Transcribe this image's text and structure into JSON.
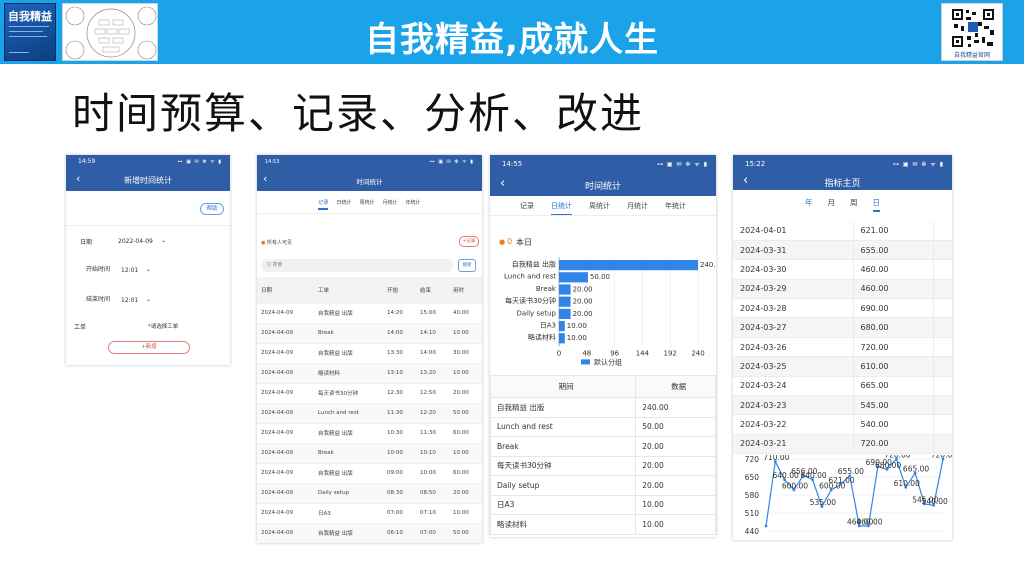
{
  "banner": {
    "title": "自我精益,成就人生",
    "book_title": "自我精益",
    "qr_caption": "自我精益官网",
    "accent": "#1aa3e8"
  },
  "main_title": "时间预算、记录、分析、改进",
  "phone1": {
    "time": "14:59",
    "status_icons": "⊶ ▣ ✉ ✻ ᯤ ▮",
    "title": "新增时间统计",
    "help_button": "帮助",
    "date_label": "日期",
    "date_value": "2022-04-09",
    "start_label": "开始时间",
    "start_value": "12:01",
    "end_label": "结束时间",
    "end_value": "12:01",
    "ticket_label": "工单",
    "ticket_placeholder": "*请选择工单",
    "add_button": "+新增"
  },
  "phone2": {
    "time": "14:53",
    "status_icons": "⊶ ▣ ✉ ✻ ᯤ ▮",
    "title": "时间统计",
    "tabs": [
      "记录",
      "日统计",
      "周统计",
      "月统计",
      "年统计"
    ],
    "visibility": "所有人可见",
    "record_button": "+记录",
    "search_placeholder": "Q 搜索",
    "search_button": "搜索",
    "columns": [
      "日期",
      "工单",
      "开始",
      "结束",
      "用时"
    ],
    "rows": [
      [
        "2024-04-09",
        "自我精益 出版",
        "14:20",
        "15:00",
        "40.00"
      ],
      [
        "2024-04-09",
        "Break",
        "14:00",
        "14:10",
        "10.00"
      ],
      [
        "2024-04-09",
        "自我精益 出版",
        "13:30",
        "14:00",
        "30.00"
      ],
      [
        "2024-04-09",
        "略读材料",
        "13:10",
        "13:20",
        "10.00"
      ],
      [
        "2024-04-09",
        "每天读书30分钟",
        "12:30",
        "12:50",
        "20.00"
      ],
      [
        "2024-04-09",
        "Lunch and rest",
        "11:30",
        "12:20",
        "50.00"
      ],
      [
        "2024-04-09",
        "自我精益 出版",
        "10:30",
        "11:30",
        "60.00"
      ],
      [
        "2024-04-09",
        "Break",
        "10:00",
        "10:10",
        "10.00"
      ],
      [
        "2024-04-09",
        "自我精益 出版",
        "09:00",
        "10:00",
        "60.00"
      ],
      [
        "2024-04-09",
        "Daily setup",
        "08:30",
        "08:50",
        "20.00"
      ],
      [
        "2024-04-09",
        "日A3",
        "07:00",
        "07:10",
        "10.00"
      ],
      [
        "2024-04-09",
        "自我精益 出版",
        "06:10",
        "07:00",
        "50.00"
      ]
    ]
  },
  "phone3": {
    "time": "14:55",
    "status_icons": "⊶ ▣ ✉ ✻ ᯤ ▮",
    "title": "时间统计",
    "tabs": [
      "记录",
      "日统计",
      "周统计",
      "月统计",
      "年统计"
    ],
    "active_tab": 1,
    "period_label": "本日",
    "period_dot": "0",
    "legend": "默认分组",
    "table_headers": [
      "期间",
      "数据"
    ],
    "table_rows": [
      [
        "自我精益 出版",
        "240.00"
      ],
      [
        "Lunch and rest",
        "50.00"
      ],
      [
        "Break",
        "20.00"
      ],
      [
        "每天读书30分钟",
        "20.00"
      ],
      [
        "Daily setup",
        "20.00"
      ],
      [
        "日A3",
        "10.00"
      ],
      [
        "略读材料",
        "10.00"
      ]
    ]
  },
  "chart_data": [
    {
      "type": "bar",
      "orientation": "horizontal",
      "categories": [
        "自我精益 出版",
        "Lunch and rest",
        "Break",
        "每天读书30分钟",
        "Daily setup",
        "日A3",
        "略读材料"
      ],
      "values": [
        240,
        50,
        20,
        20,
        20,
        10,
        10
      ],
      "value_labels": [
        "240.",
        "50.00",
        "20.00",
        "20.00",
        "20.00",
        "10.00",
        "10.00"
      ],
      "xlim": [
        0,
        240
      ],
      "xticks": [
        "0",
        "48",
        "96",
        "144",
        "192",
        "240"
      ],
      "series": [
        {
          "name": "默认分组",
          "values": [
            240,
            50,
            20,
            20,
            20,
            10,
            10
          ]
        }
      ],
      "legend_position": "bottom",
      "color": "#2f86e8"
    },
    {
      "type": "line",
      "values": [
        460,
        710,
        640,
        600,
        656,
        640,
        535,
        600,
        621,
        655,
        460,
        460,
        690,
        680,
        720,
        610,
        665,
        545,
        540,
        720
      ],
      "point_labels": [
        "",
        "710.00",
        "640.00",
        "600.00",
        "656.00",
        "640.00",
        "535.00",
        "600.00",
        "621.00",
        "655.00",
        "460.00",
        "460.00",
        "690.00",
        "680.00",
        "720.00",
        "610.00",
        "665.00",
        "545.00",
        "540.00",
        "720.00"
      ],
      "ylim": [
        440,
        720
      ],
      "yticks": [
        "720",
        "650",
        "580",
        "510",
        "440"
      ],
      "color": "#2f86e8",
      "grid": true
    }
  ],
  "phone4": {
    "time": "15:22",
    "status_icons": "⊶ ▣ ✉ ✻ ᯤ ▮",
    "title": "指标主页",
    "tabs": [
      "年",
      "月",
      "周",
      "日"
    ],
    "active_tab": 3,
    "rows": [
      [
        "2024-04-01",
        "621.00"
      ],
      [
        "2024-03-31",
        "655.00"
      ],
      [
        "2024-03-30",
        "460.00"
      ],
      [
        "2024-03-29",
        "460.00"
      ],
      [
        "2024-03-28",
        "690.00"
      ],
      [
        "2024-03-27",
        "680.00"
      ],
      [
        "2024-03-26",
        "720.00"
      ],
      [
        "2024-03-25",
        "610.00"
      ],
      [
        "2024-03-24",
        "665.00"
      ],
      [
        "2024-03-23",
        "545.00"
      ],
      [
        "2024-03-22",
        "540.00"
      ],
      [
        "2024-03-21",
        "720.00"
      ]
    ]
  }
}
